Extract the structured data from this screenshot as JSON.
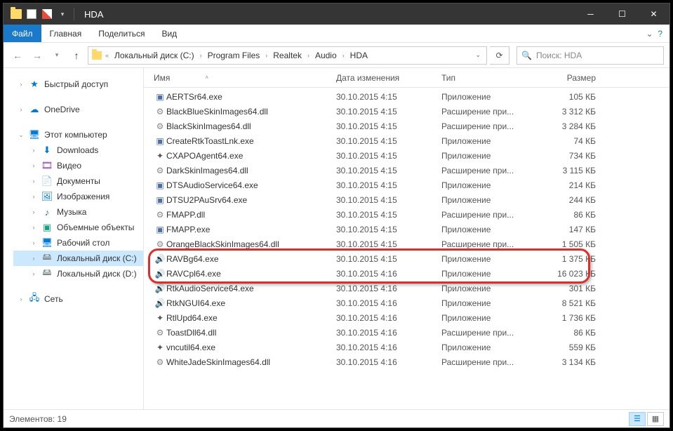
{
  "title": "HDA",
  "menu": {
    "file": "Файл",
    "home": "Главная",
    "share": "Поделиться",
    "view": "Вид"
  },
  "breadcrumb": [
    "Локальный диск (C:)",
    "Program Files",
    "Realtek",
    "Audio",
    "HDA"
  ],
  "search_placeholder": "Поиск: HDA",
  "columns": {
    "name": "Имя",
    "date": "Дата изменения",
    "type": "Тип",
    "size": "Размер"
  },
  "sidebar": {
    "quick": "Быстрый доступ",
    "onedrive": "OneDrive",
    "thispc": "Этот компьютер",
    "downloads": "Downloads",
    "video": "Видео",
    "documents": "Документы",
    "pictures": "Изображения",
    "music": "Музыка",
    "objects3d": "Объемные объекты",
    "desktop": "Рабочий стол",
    "diskc": "Локальный диск (C:)",
    "diskd": "Локальный диск (D:)",
    "network": "Сеть"
  },
  "files": [
    {
      "name": "AERTSr64.exe",
      "date": "30.10.2015 4:15",
      "type": "Приложение",
      "size": "105 КБ",
      "ico": "exe"
    },
    {
      "name": "BlackBlueSkinImages64.dll",
      "date": "30.10.2015 4:15",
      "type": "Расширение при...",
      "size": "3 312 КБ",
      "ico": "dll"
    },
    {
      "name": "BlackSkinImages64.dll",
      "date": "30.10.2015 4:15",
      "type": "Расширение при...",
      "size": "3 284 КБ",
      "ico": "dll"
    },
    {
      "name": "CreateRtkToastLnk.exe",
      "date": "30.10.2015 4:15",
      "type": "Приложение",
      "size": "74 КБ",
      "ico": "exe"
    },
    {
      "name": "CXAPOAgent64.exe",
      "date": "30.10.2015 4:15",
      "type": "Приложение",
      "size": "734 КБ",
      "ico": "svc"
    },
    {
      "name": "DarkSkinImages64.dll",
      "date": "30.10.2015 4:15",
      "type": "Расширение при...",
      "size": "3 115 КБ",
      "ico": "dll"
    },
    {
      "name": "DTSAudioService64.exe",
      "date": "30.10.2015 4:15",
      "type": "Приложение",
      "size": "214 КБ",
      "ico": "exe"
    },
    {
      "name": "DTSU2PAuSrv64.exe",
      "date": "30.10.2015 4:15",
      "type": "Приложение",
      "size": "244 КБ",
      "ico": "exe"
    },
    {
      "name": "FMAPP.dll",
      "date": "30.10.2015 4:15",
      "type": "Расширение при...",
      "size": "86 КБ",
      "ico": "dll"
    },
    {
      "name": "FMAPP.exe",
      "date": "30.10.2015 4:15",
      "type": "Приложение",
      "size": "147 КБ",
      "ico": "exe"
    },
    {
      "name": "OrangeBlackSkinImages64.dll",
      "date": "30.10.2015 4:15",
      "type": "Расширение при...",
      "size": "1 505 КБ",
      "ico": "dll"
    },
    {
      "name": "RAVBg64.exe",
      "date": "30.10.2015 4:15",
      "type": "Приложение",
      "size": "1 375 КБ",
      "ico": "snd"
    },
    {
      "name": "RAVCpl64.exe",
      "date": "30.10.2015 4:16",
      "type": "Приложение",
      "size": "16 023 КБ",
      "ico": "snd"
    },
    {
      "name": "RtkAudioService64.exe",
      "date": "30.10.2015 4:16",
      "type": "Приложение",
      "size": "301 КБ",
      "ico": "snd"
    },
    {
      "name": "RtkNGUI64.exe",
      "date": "30.10.2015 4:16",
      "type": "Приложение",
      "size": "8 521 КБ",
      "ico": "snd"
    },
    {
      "name": "RtlUpd64.exe",
      "date": "30.10.2015 4:16",
      "type": "Приложение",
      "size": "1 736 КБ",
      "ico": "svc"
    },
    {
      "name": "ToastDll64.dll",
      "date": "30.10.2015 4:16",
      "type": "Расширение при...",
      "size": "86 КБ",
      "ico": "dll"
    },
    {
      "name": "vncutil64.exe",
      "date": "30.10.2015 4:16",
      "type": "Приложение",
      "size": "559 КБ",
      "ico": "svc"
    },
    {
      "name": "WhiteJadeSkinImages64.dll",
      "date": "30.10.2015 4:16",
      "type": "Расширение при...",
      "size": "3 134 КБ",
      "ico": "dll"
    }
  ],
  "highlight_index": 12,
  "status": "Элементов: 19"
}
